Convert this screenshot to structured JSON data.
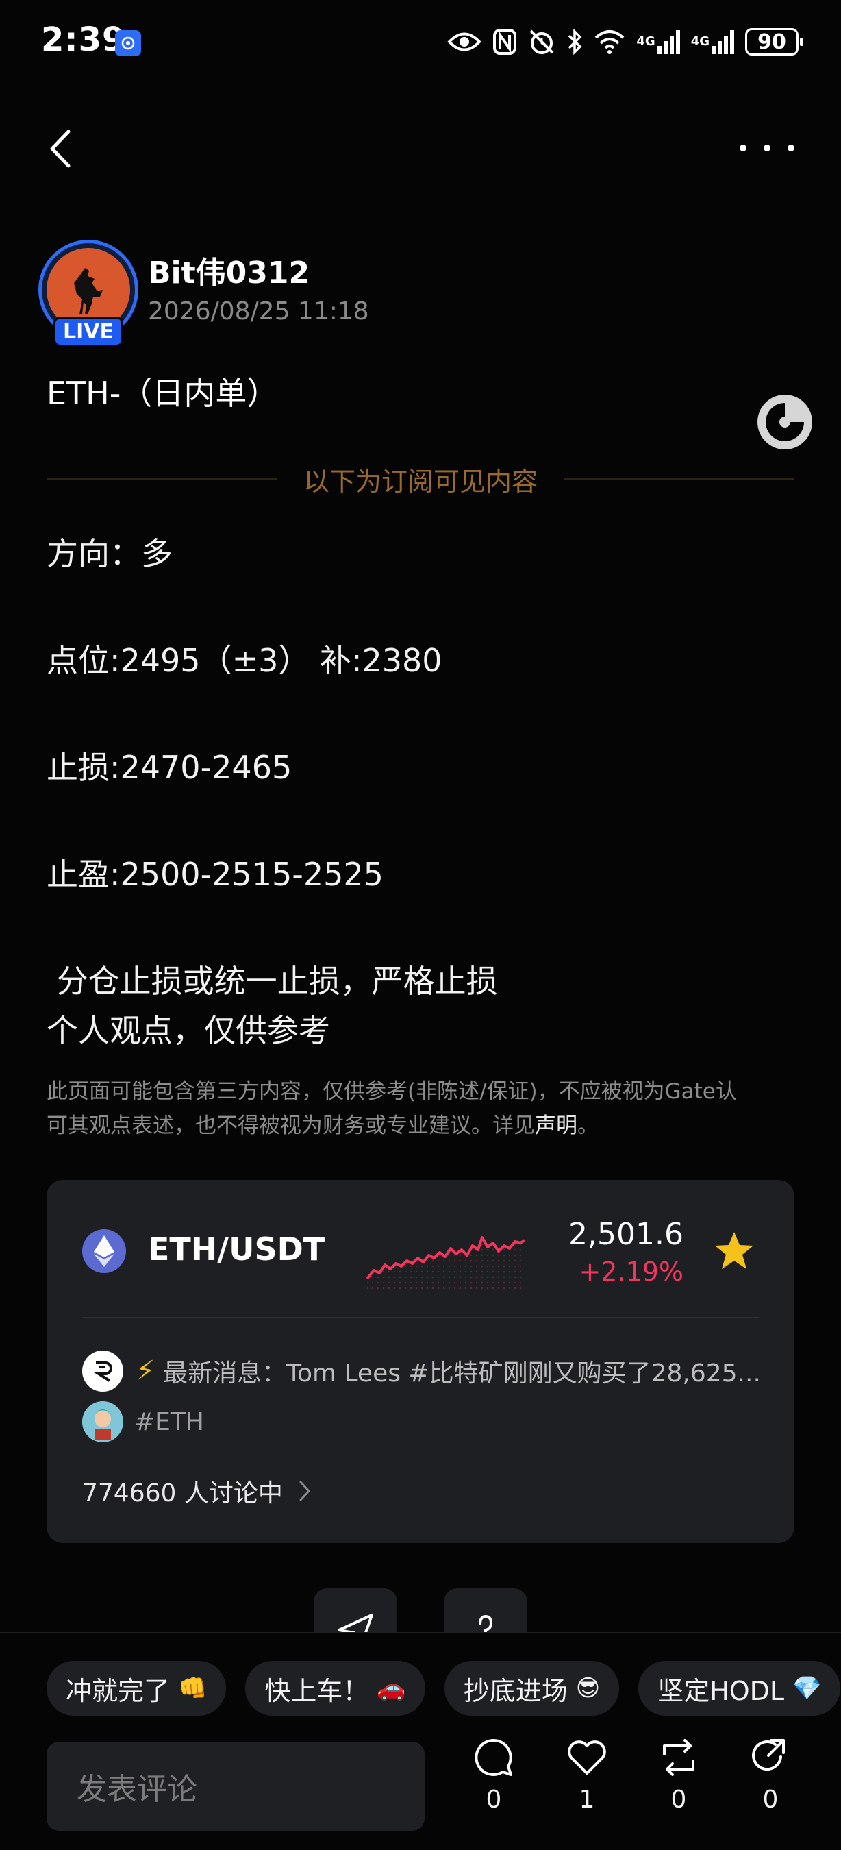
{
  "status_bar": {
    "time": "2:39",
    "network_1": "4G",
    "network_2": "4G",
    "battery": "90"
  },
  "post": {
    "author": "Bit伟0312",
    "live_label": "LIVE",
    "time": "2026/08/25 11:18",
    "title": "ETH-（日内单）",
    "subscriber_divider": "以下为订阅可见内容",
    "lines": [
      "方向：多",
      "点位:2495（±3） 补:2380",
      "止损:2470-2465",
      "止盈:2500-2515-2525",
      " 分仓止损或统一止损，严格止损",
      "个人观点，仅供参考"
    ],
    "disclaimer_line1": "此页面可能包含第三方内容，仅供参考(非陈述/保证)，不应被视为Gate认",
    "disclaimer_line2": "可其观点表述，也不得被视为财务或专业建议。详见",
    "disclaimer_link": "声明",
    "disclaimer_end": "。"
  },
  "market_card": {
    "pair": "ETH/USDT",
    "price": "2,501.6",
    "change": "+2.19%",
    "news": "最新消息：Tom Lees #比特矿刚刚又购买了28,625...",
    "tag": "#ETH",
    "discussion": "774660 人讨论中",
    "colors": {
      "up": "#f0365e",
      "star": "#f5c21b"
    }
  },
  "quick_replies": [
    {
      "label": "冲就完了",
      "emoji": "👊"
    },
    {
      "label": "快上车！",
      "emoji": "🚗"
    },
    {
      "label": "抄底进场",
      "emoji": "😎"
    },
    {
      "label": "坚定HODL",
      "emoji": "💎"
    }
  ],
  "comment": {
    "placeholder": "发表评论"
  },
  "actions": {
    "comments": "0",
    "likes": "1",
    "reposts": "0",
    "shares": "0"
  }
}
